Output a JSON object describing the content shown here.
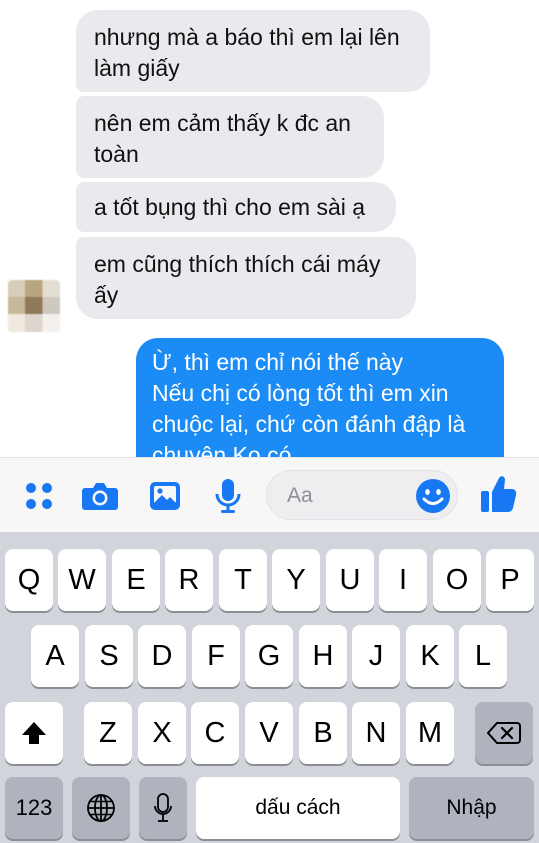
{
  "chat": {
    "incoming": [
      "nhưng mà a báo thì em lại lên\nlàm giấy",
      "nên em cảm thấy k đc an\ntoàn",
      "a tốt bụng thì cho em sài ạ",
      "em cũng thích thích cái máy\nấy"
    ],
    "outgoing_lines": [
      "Ừ, thì em chỉ nói thế này",
      "Nếu chị có lòng tốt thì em xin",
      "chuộc lại, chứ còn đánh đập là",
      "chuyện Ko có..."
    ]
  },
  "composer": {
    "placeholder": "Aa",
    "icons": [
      "apps-grid-icon",
      "camera-icon",
      "gallery-icon",
      "microphone-icon",
      "emoji-icon",
      "thumbs-up-icon"
    ],
    "accent_color": "#1877f2"
  },
  "keyboard": {
    "row1": [
      "Q",
      "W",
      "E",
      "R",
      "T",
      "Y",
      "U",
      "I",
      "O",
      "P"
    ],
    "row2": [
      "A",
      "S",
      "D",
      "F",
      "G",
      "H",
      "J",
      "K",
      "L"
    ],
    "row3": [
      "Z",
      "X",
      "C",
      "V",
      "B",
      "N",
      "M"
    ],
    "numbers_key": "123",
    "space_key": "dấu cách",
    "return_key": "Nhập"
  },
  "colors": {
    "incoming_bubble": "#eaeaee",
    "outgoing_bubble": "#1b8cf5",
    "keyboard_bg": "#d1d4da"
  }
}
